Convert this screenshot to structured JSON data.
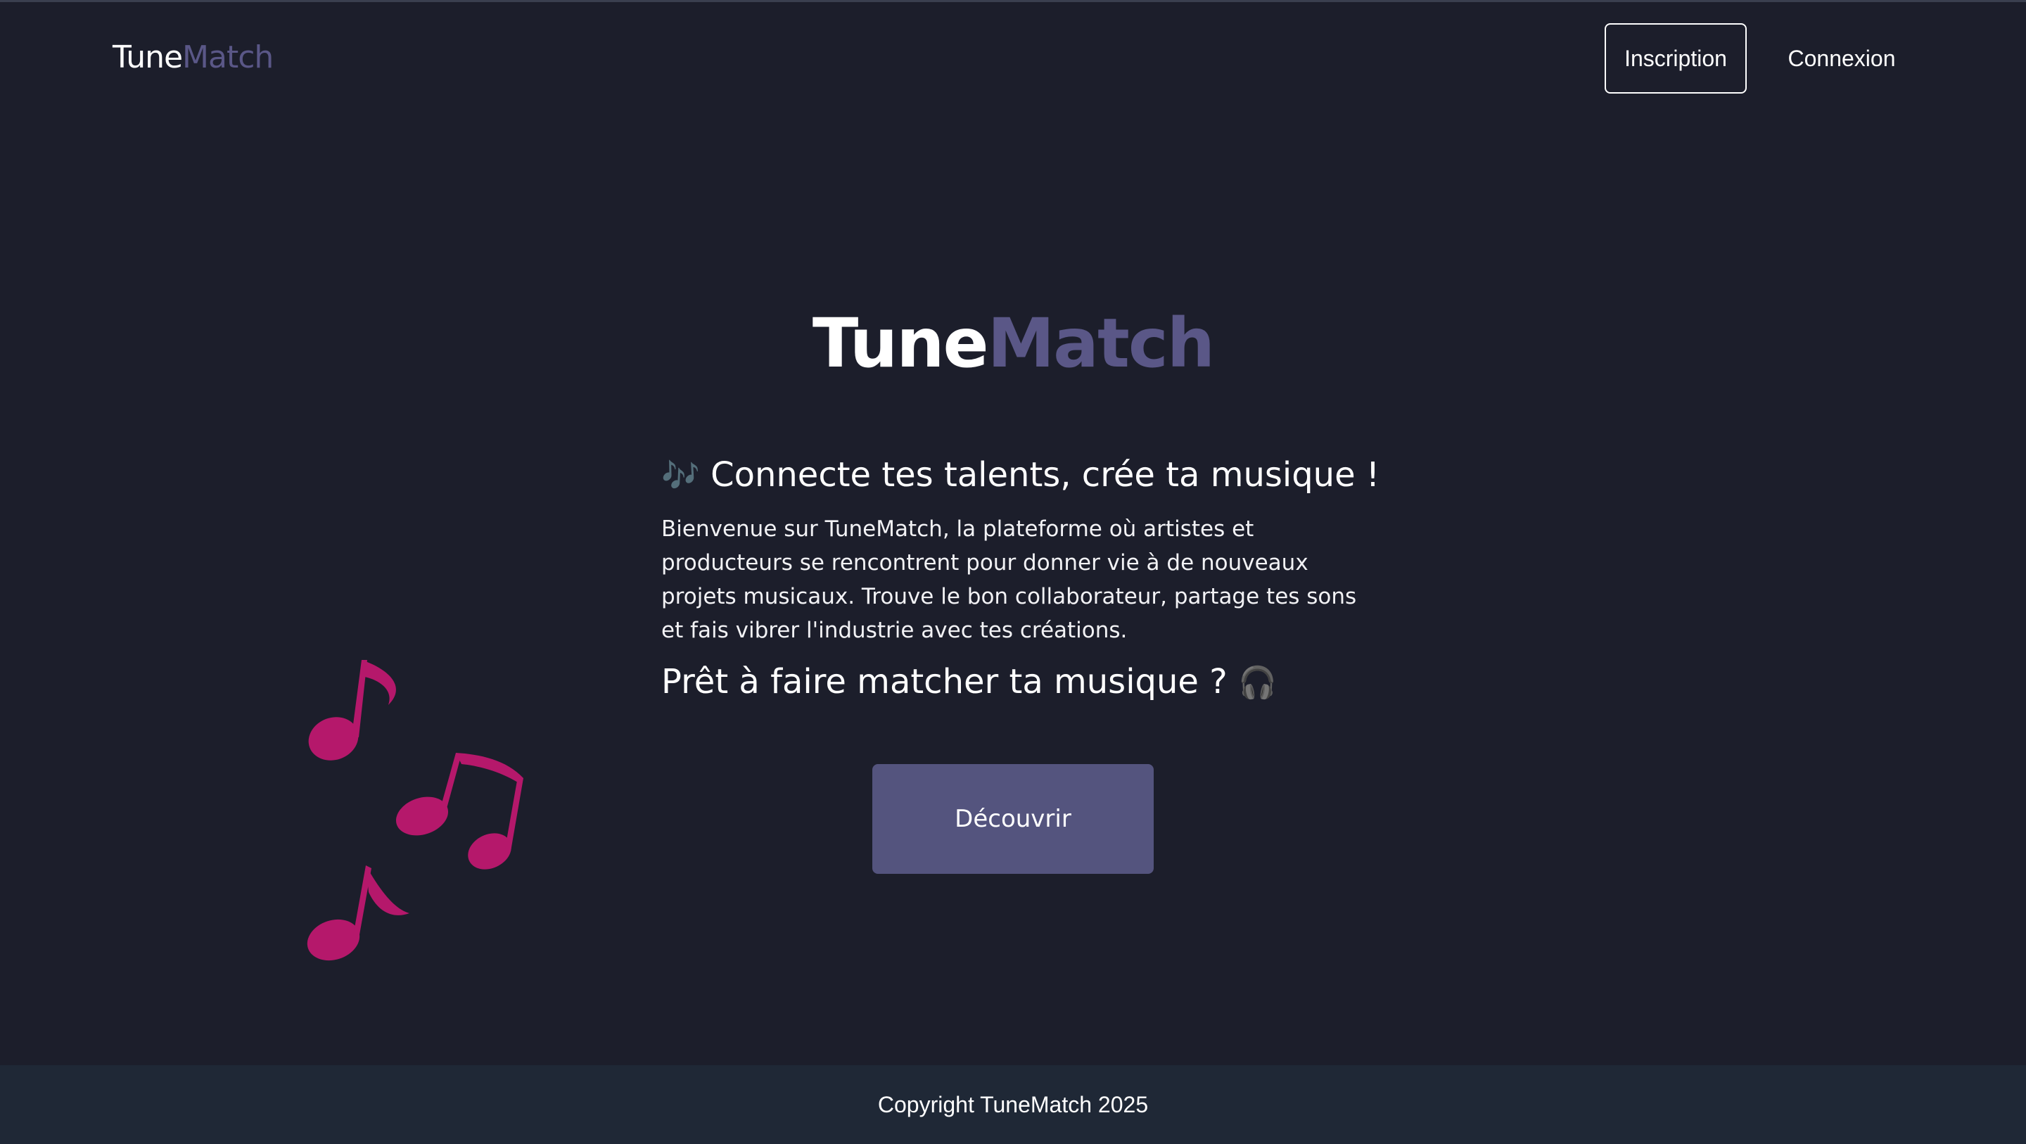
{
  "header": {
    "logo": {
      "part1": "Tune",
      "part2": "Match"
    },
    "nav": {
      "inscription_label": "Inscription",
      "connexion_label": "Connexion"
    }
  },
  "hero": {
    "title": {
      "part1": "Tune",
      "part2": "Match"
    },
    "tagline_emoji": "🎶",
    "tagline": "Connecte tes talents, crée ta musique !",
    "intro": "Bienvenue sur TuneMatch, la plateforme où artistes et producteurs se rencontrent pour donner vie à de nouveaux projets musicaux. Trouve le bon collaborateur, partage tes sons et fais vibrer l'industrie avec tes créations.",
    "cta_text": "Prêt à faire matcher ta musique ?",
    "cta_emoji": "🎧",
    "button_label": "Découvrir"
  },
  "decoration": {
    "icon": "music-notes-icon",
    "color": "#b5186b"
  },
  "footer": {
    "copyright": "Copyright TuneMatch 2025"
  },
  "colors": {
    "background": "#1c1e2b",
    "accent": "#5a5787",
    "button": "#54547e",
    "footer": "#1f2836"
  }
}
